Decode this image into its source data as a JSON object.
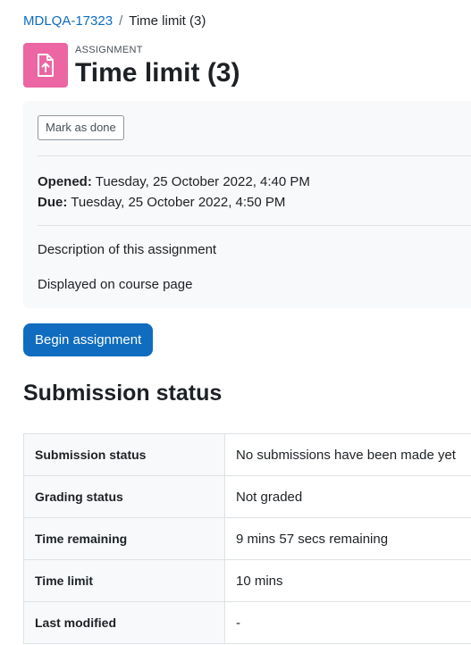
{
  "breadcrumb": {
    "course": "MDLQA-17323",
    "separator": "/",
    "current": "Time limit (3)"
  },
  "header": {
    "icon": "assignment-upload-icon",
    "icon_bg": "#eb66a2",
    "purpose": "ASSIGNMENT",
    "title": "Time limit (3)"
  },
  "activity": {
    "mark_done_label": "Mark as done",
    "opened_label": "Opened:",
    "opened_value": "Tuesday, 25 October 2022, 4:40 PM",
    "due_label": "Due:",
    "due_value": "Tuesday, 25 October 2022, 4:50 PM",
    "description": "Description of this assignment",
    "displayed_note": "Displayed on course page"
  },
  "actions": {
    "begin_label": "Begin assignment",
    "accent": "#0f6cbf"
  },
  "submission": {
    "heading": "Submission status",
    "rows": [
      {
        "label": "Submission status",
        "value": "No submissions have been made yet"
      },
      {
        "label": "Grading status",
        "value": "Not graded"
      },
      {
        "label": "Time remaining",
        "value": "9 mins 57 secs remaining"
      },
      {
        "label": "Time limit",
        "value": "10 mins"
      },
      {
        "label": "Last modified",
        "value": "-"
      }
    ]
  }
}
